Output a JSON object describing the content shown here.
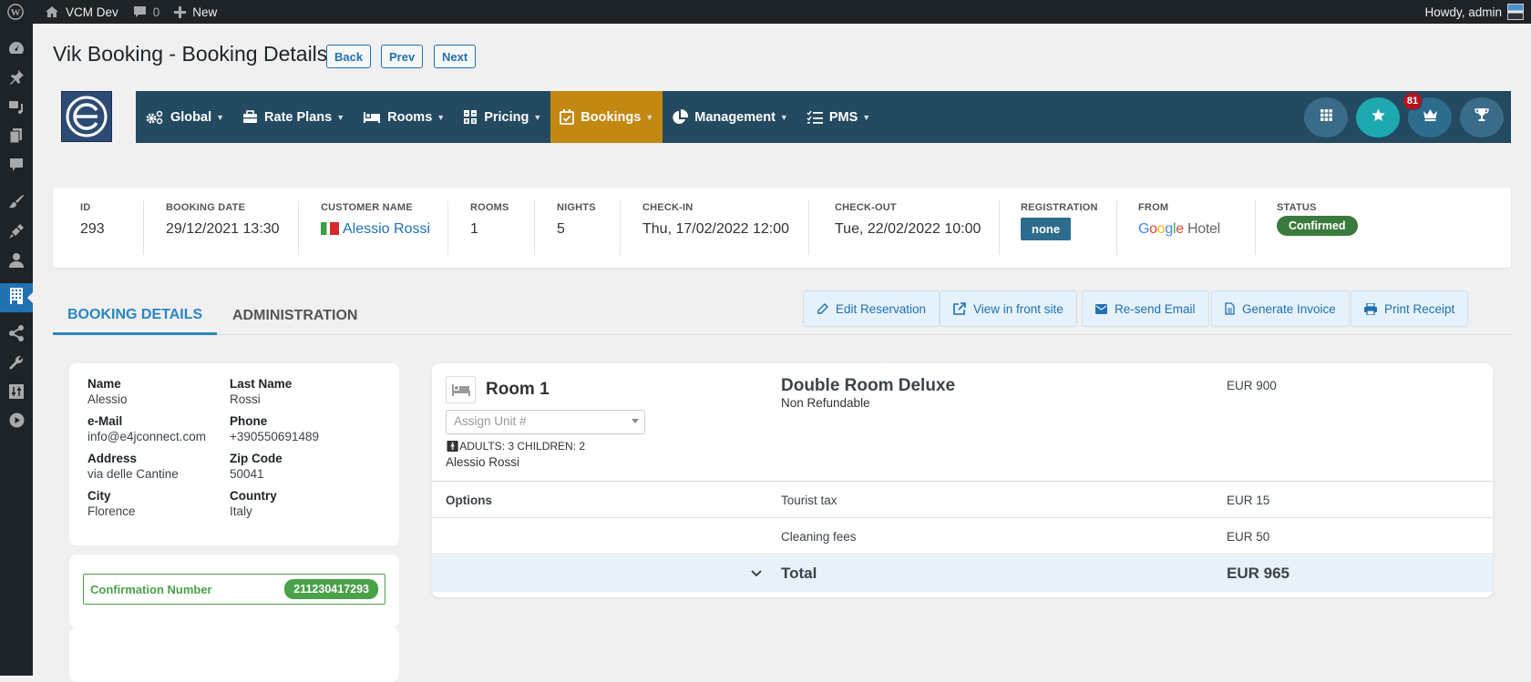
{
  "adminbar": {
    "site_name": "VCM Dev",
    "comments_count": "0",
    "new_label": "New",
    "howdy": "Howdy, admin"
  },
  "page": {
    "title": "Vik Booking - Booking Details",
    "buttons": {
      "back": "Back",
      "prev": "Prev",
      "next": "Next"
    }
  },
  "menu": {
    "items": [
      {
        "label": "Global",
        "icon": "gears-icon"
      },
      {
        "label": "Rate Plans",
        "icon": "briefcase-icon"
      },
      {
        "label": "Rooms",
        "icon": "bed-icon"
      },
      {
        "label": "Pricing",
        "icon": "calculator-icon"
      },
      {
        "label": "Bookings",
        "icon": "calendar-check-icon",
        "active": true
      },
      {
        "label": "Management",
        "icon": "pie-chart-icon"
      },
      {
        "label": "PMS",
        "icon": "tasks-icon"
      }
    ],
    "notification_badge": "81",
    "colors": {
      "bar": "#234a61",
      "active": "#c28811"
    }
  },
  "summary": {
    "id": {
      "label": "ID",
      "value": "293"
    },
    "booking_date": {
      "label": "BOOKING DATE",
      "value": "29/12/2021 13:30"
    },
    "customer": {
      "label": "CUSTOMER NAME",
      "value": "Alessio Rossi",
      "country_flag": "Italy"
    },
    "rooms": {
      "label": "ROOMS",
      "value": "1"
    },
    "nights": {
      "label": "NIGHTS",
      "value": "5"
    },
    "checkin": {
      "label": "CHECK-IN",
      "value": "Thu, 17/02/2022 12:00"
    },
    "checkout": {
      "label": "CHECK-OUT",
      "value": "Tue, 22/02/2022 10:00"
    },
    "registration": {
      "label": "REGISTRATION",
      "value": "none"
    },
    "from": {
      "label": "FROM",
      "value_brand": "Google",
      "value_suffix": "Hotel"
    },
    "status": {
      "label": "STATUS",
      "value": "Confirmed",
      "color": "#3b7a3d"
    }
  },
  "tabs": {
    "booking_details": "BOOKING DETAILS",
    "administration": "ADMINISTRATION"
  },
  "actions": {
    "edit": "Edit Reservation",
    "view": "View in front site",
    "resend": "Re-send Email",
    "invoice": "Generate Invoice",
    "print": "Print Receipt"
  },
  "customer": {
    "fields": [
      {
        "label": "Name",
        "value": "Alessio"
      },
      {
        "label": "Last Name",
        "value": "Rossi"
      },
      {
        "label": "e-Mail",
        "value": "info@e4jconnect.com"
      },
      {
        "label": "Phone",
        "value": "+390550691489"
      },
      {
        "label": "Address",
        "value": "via delle Cantine"
      },
      {
        "label": "Zip Code",
        "value": "50041"
      },
      {
        "label": "City",
        "value": "Florence"
      },
      {
        "label": "Country",
        "value": "Italy"
      }
    ],
    "confirmation": {
      "label": "Confirmation Number",
      "value": "211230417293"
    }
  },
  "room": {
    "name": "Room 1",
    "assign_placeholder": "Assign Unit #",
    "guests": "ADULTS: 3 CHILDREN: 2",
    "guest_name": "Alessio Rossi",
    "type": "Double Room Deluxe",
    "rate_plan": "Non Refundable",
    "price": "EUR 900",
    "options_label": "Options",
    "options": [
      {
        "name": "Tourist tax",
        "price": "EUR 15"
      },
      {
        "name": "Cleaning fees",
        "price": "EUR 50"
      }
    ],
    "total_label": "Total",
    "total": "EUR 965"
  }
}
